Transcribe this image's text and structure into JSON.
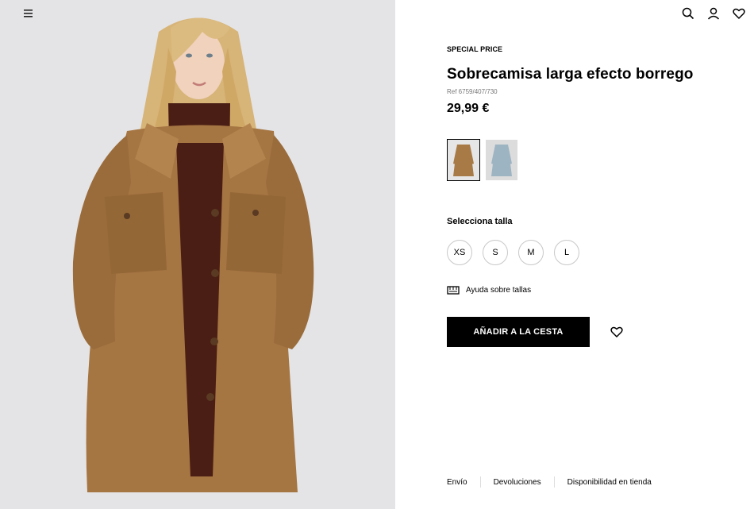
{
  "header": {
    "menu_icon": "hamburger-menu-icon",
    "icons": [
      "search-icon",
      "user-icon",
      "heart-icon"
    ]
  },
  "product": {
    "badge": "SPECIAL PRICE",
    "title": "Sobrecamisa larga efecto borrego",
    "ref": "Ref 6759/407/730",
    "price": "29,99 €",
    "colors": [
      {
        "name": "camel",
        "hex": "#a87a45",
        "selected": true
      },
      {
        "name": "light-blue",
        "hex": "#9db4c3",
        "selected": false
      }
    ]
  },
  "sizes": {
    "label": "Selecciona talla",
    "options": [
      "XS",
      "S",
      "M",
      "L"
    ],
    "help_label": "Ayuda sobre tallas"
  },
  "actions": {
    "add_to_cart": "AÑADIR A LA CESTA",
    "wishlist_icon": "heart-icon"
  },
  "footer": {
    "links": [
      "Envío",
      "Devoluciones",
      "Disponibilidad en tienda"
    ]
  },
  "colors": {
    "background_left": "#e4e4e6",
    "coat": "#a57542",
    "button": "#000000"
  }
}
